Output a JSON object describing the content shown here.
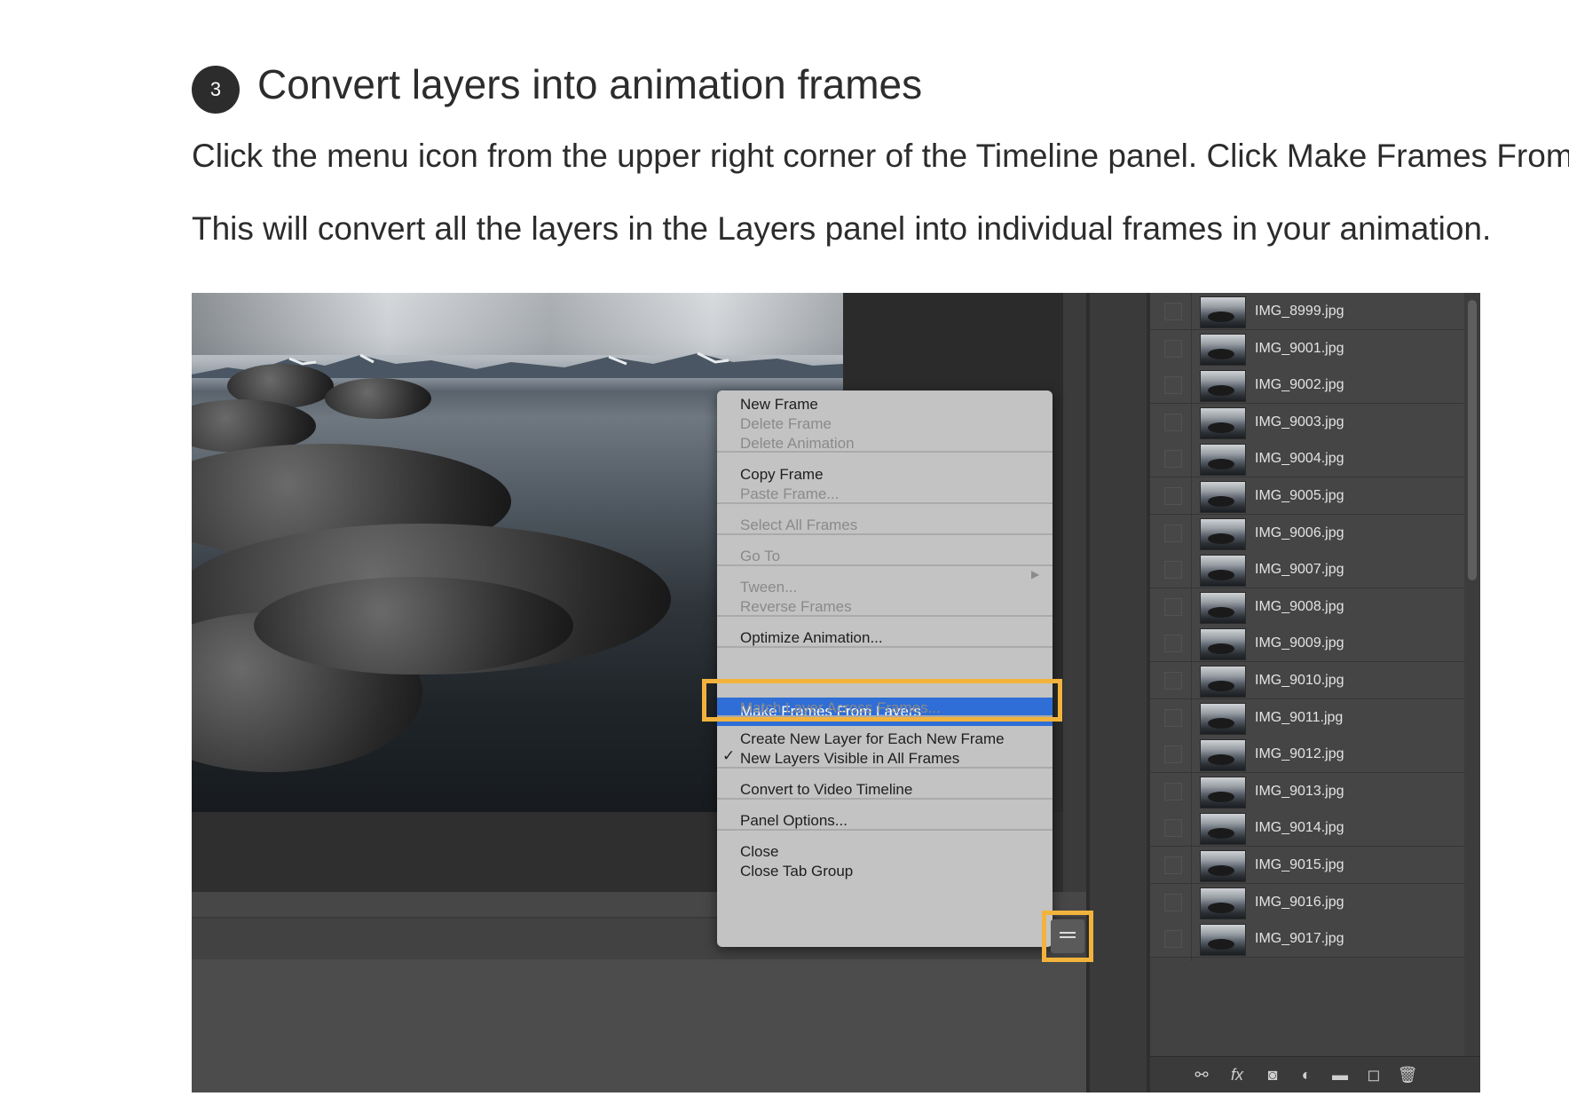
{
  "step": {
    "number": "3",
    "title": "Convert layers into animation frames"
  },
  "body": {
    "paragraph1": "Click the menu icon from the upper right corner of the Timeline panel. Click Make Frames From",
    "paragraph2": "This will convert all the layers in the Layers panel into individual frames in your animation."
  },
  "menu": {
    "items": [
      {
        "label": "New Frame",
        "disabled": false
      },
      {
        "label": "Delete Frame",
        "disabled": true
      },
      {
        "label": "Delete Animation",
        "disabled": true
      },
      {
        "label": "Copy Frame",
        "disabled": false
      },
      {
        "label": "Paste Frame...",
        "disabled": true
      },
      {
        "label": "Select All Frames",
        "disabled": true
      },
      {
        "label": "Go To",
        "disabled": true
      },
      {
        "label": "Tween...",
        "disabled": true
      },
      {
        "label": "Reverse Frames",
        "disabled": true
      },
      {
        "label": "Optimize Animation...",
        "disabled": false
      },
      {
        "label": "Make Frames From Layers",
        "disabled": false
      },
      {
        "label": "Match Layer Across Frames...",
        "disabled": true
      },
      {
        "label": "Create New Layer for Each New Frame",
        "disabled": false
      },
      {
        "label": "New Layers Visible in All Frames",
        "disabled": false
      },
      {
        "label": "Convert to Video Timeline",
        "disabled": false
      },
      {
        "label": "Panel Options...",
        "disabled": false
      },
      {
        "label": "Close",
        "disabled": false
      },
      {
        "label": "Close Tab Group",
        "disabled": false
      }
    ],
    "checkmark": "✓",
    "submenu_arrow": "▶"
  },
  "layers": [
    "IMG_8999.jpg",
    "IMG_9001.jpg",
    "IMG_9002.jpg",
    "IMG_9003.jpg",
    "IMG_9004.jpg",
    "IMG_9005.jpg",
    "IMG_9006.jpg",
    "IMG_9007.jpg",
    "IMG_9008.jpg",
    "IMG_9009.jpg",
    "IMG_9010.jpg",
    "IMG_9011.jpg",
    "IMG_9012.jpg",
    "IMG_9013.jpg",
    "IMG_9014.jpg",
    "IMG_9015.jpg",
    "IMG_9016.jpg",
    "IMG_9017.jpg"
  ],
  "layers_footer": {
    "icons": [
      "link-icon",
      "fx-icon",
      "mask-icon",
      "adjustment-icon",
      "folder-icon",
      "new-layer-icon",
      "trash-icon"
    ],
    "fx_label": "fx"
  },
  "colors": {
    "callout": "#f2b33d",
    "highlight": "#2f6ed6"
  }
}
